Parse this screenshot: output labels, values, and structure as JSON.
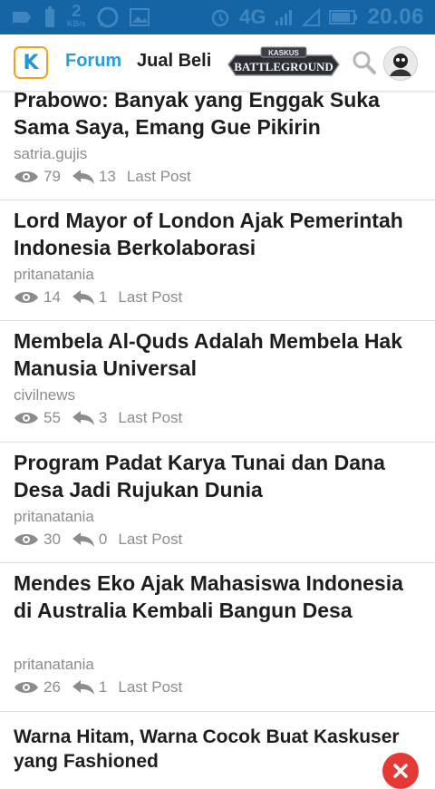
{
  "statusbar": {
    "net_speed": "2",
    "net_unit": "KB/s",
    "network": "4G",
    "time": "20.06"
  },
  "header": {
    "nav_forum": "Forum",
    "nav_jual_beli": "Jual Beli",
    "banner_top": "KASKUS",
    "banner_bottom": "BATTLEGROUND"
  },
  "threads": [
    {
      "title": "Prabowo: Banyak yang Enggak Suka Sama Saya, Emang Gue Pikirin",
      "author": "satria.gujis",
      "views": "79",
      "replies": "13",
      "last_post": "Last Post"
    },
    {
      "title": "Lord Mayor of London Ajak Pemerintah Indonesia Berkolaborasi",
      "author": "pritanatania",
      "views": "14",
      "replies": "1",
      "last_post": "Last Post"
    },
    {
      "title": "Membela Al-Quds Adalah Membela Hak Manusia Universal",
      "author": "civilnews",
      "views": "55",
      "replies": "3",
      "last_post": "Last Post"
    },
    {
      "title": "Program Padat Karya Tunai dan Dana Desa Jadi Rujukan Dunia",
      "author": "pritanatania",
      "views": "30",
      "replies": "0",
      "last_post": "Last Post"
    },
    {
      "title": "Mendes Eko Ajak Mahasiswa Indonesia di Australia Kembali Bangun Desa",
      "author": "pritanatania",
      "views": "26",
      "replies": "1",
      "last_post": "Last Post"
    },
    {
      "title": "Warna Hitam, Warna Cocok Buat Kaskuser yang Fashioned"
    }
  ],
  "colors": {
    "statusbar_bg": "#1565a6",
    "accent": "#2a9be0",
    "logo_border": "#f7a11a",
    "close_button": "#e53935"
  }
}
